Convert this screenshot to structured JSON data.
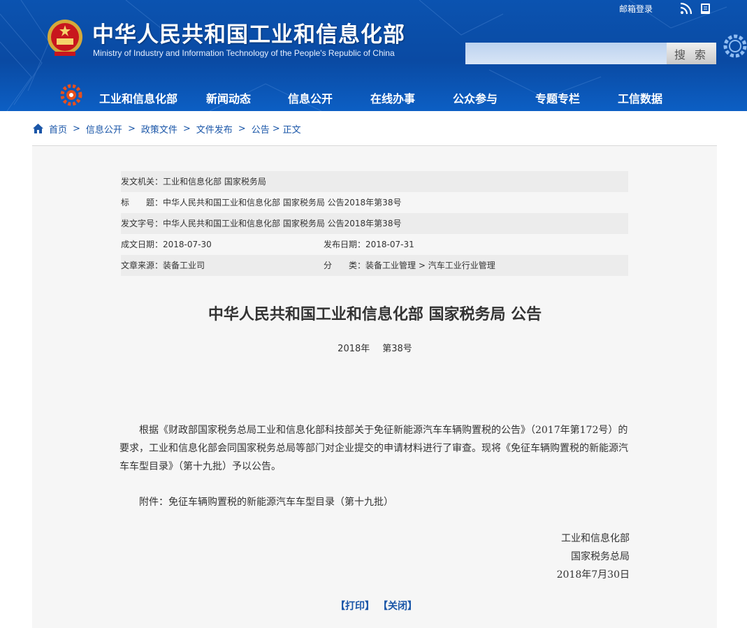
{
  "header": {
    "title": "中华人民共和国工业和信息化部",
    "subtitle": "Ministry of Industry and Information Technology of the People's Republic of China",
    "mail_login": "邮箱登录",
    "search_placeholder": "",
    "search_button": "搜 索",
    "colors": {
      "header_blue": "#0b53b0",
      "link_blue": "#1a56a8"
    },
    "icons": [
      "emblem-icon",
      "rss-icon",
      "mobile-icon",
      "gear-icon",
      "nav-logo-icon"
    ]
  },
  "nav": {
    "items": [
      {
        "label": "工业和信息化部"
      },
      {
        "label": "新闻动态"
      },
      {
        "label": "信息公开"
      },
      {
        "label": "在线办事"
      },
      {
        "label": "公众参与"
      },
      {
        "label": "专题专栏"
      },
      {
        "label": "工信数据"
      }
    ]
  },
  "breadcrumb": {
    "items": [
      "首页",
      "信息公开",
      "政策文件",
      "文件发布",
      "公告",
      "正文"
    ],
    "separator": ">"
  },
  "meta": {
    "issuer_label": "发文机关：",
    "issuer": "工业和信息化部 国家税务局",
    "title_label": "标　　题：",
    "title": "中华人民共和国工业和信息化部 国家税务局 公告2018年第38号",
    "docno_label": "发文字号：",
    "docno": "中华人民共和国工业和信息化部 国家税务局 公告2018年第38号",
    "created_label": "成文日期：",
    "created": "2018-07-30",
    "published_label": "发布日期：",
    "published": "2018-07-31",
    "source_label": "文章来源：",
    "source": "装备工业司",
    "category_label": "分　　类：",
    "category": "装备工业管理 > 汽车工业行业管理"
  },
  "document": {
    "title": "中华人民共和国工业和信息化部 国家税务局 公告",
    "year": "2018年",
    "number": "第38号",
    "body": "根据《财政部国家税务总局工业和信息化部科技部关于免征新能源汽车车辆购置税的公告》（2017年第172号）的要求，工业和信息化部会同国家税务总局等部门对企业提交的申请材料进行了审查。现将《免征车辆购置税的新能源汽车车型目录》（第十九批）予以公告。",
    "attachment": "附件：免征车辆购置税的新能源汽车车型目录（第十九批）",
    "signer1": "工业和信息化部",
    "signer2": "国家税务总局",
    "date": "2018年7月30日"
  },
  "actions": {
    "print": "【打印】",
    "close": "【关闭】"
  }
}
